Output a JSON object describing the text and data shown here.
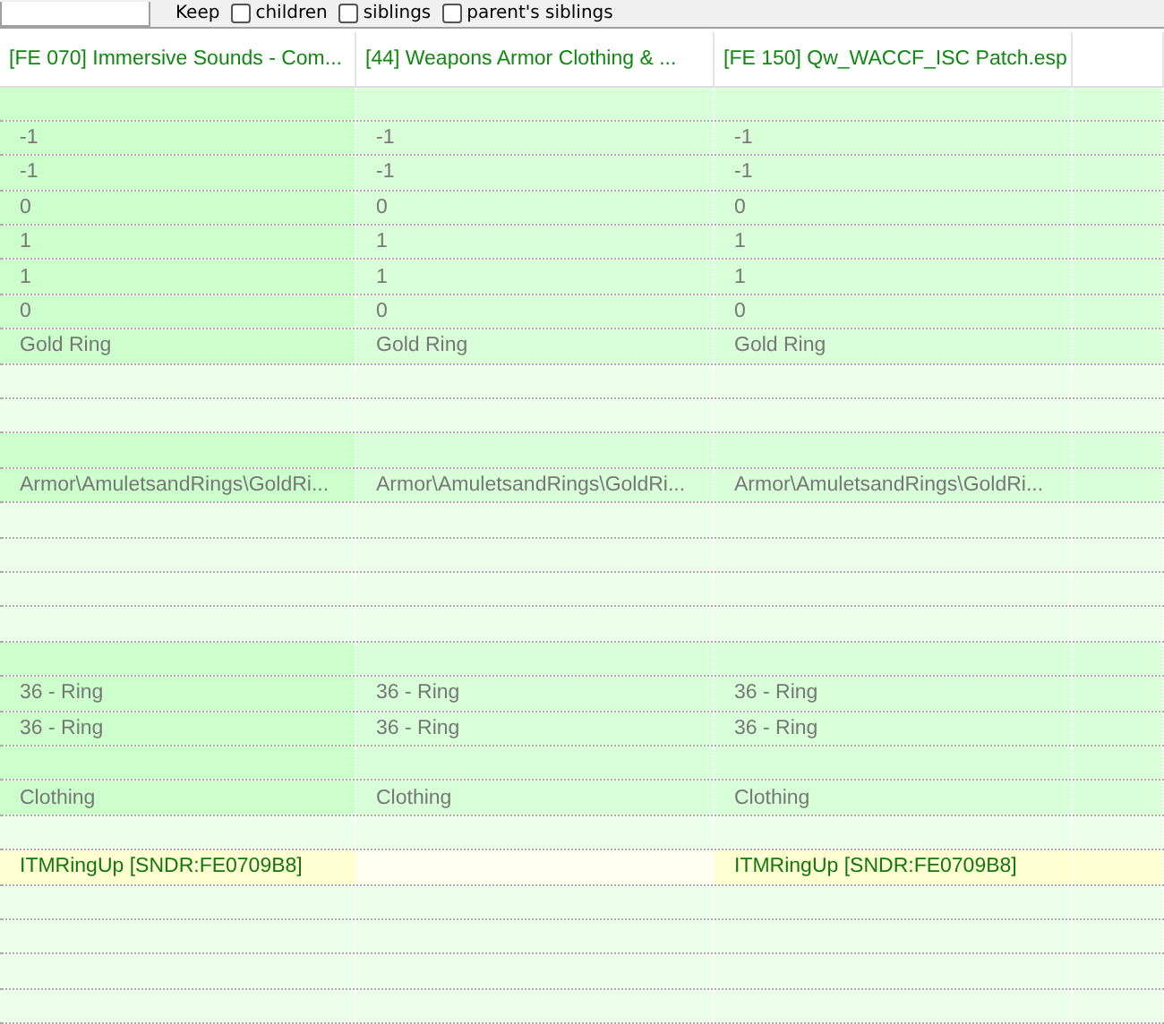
{
  "toolbar": {
    "label": "Keep",
    "options": [
      {
        "label": "children",
        "checked": false
      },
      {
        "label": "siblings",
        "checked": false
      },
      {
        "label": "parent's siblings",
        "checked": false
      }
    ]
  },
  "columns": [
    "[FE 070] Immersive Sounds - Com...",
    "[44] Weapons Armor Clothing & ...",
    "[FE 150] Qw_WACCF_ISC Patch.esp"
  ],
  "rows": [
    {
      "kind": "match"
    },
    {
      "kind": "match",
      "cells": [
        "-1",
        "-1",
        "-1"
      ]
    },
    {
      "kind": "match",
      "cells": [
        "-1",
        "-1",
        "-1"
      ]
    },
    {
      "kind": "match",
      "cells": [
        "0",
        "0",
        "0"
      ]
    },
    {
      "kind": "match",
      "cells": [
        "1",
        "1",
        "1"
      ]
    },
    {
      "kind": "match",
      "cells": [
        "1",
        "1",
        "1"
      ]
    },
    {
      "kind": "match",
      "cells": [
        "0",
        "0",
        "0"
      ]
    },
    {
      "kind": "match",
      "cells": [
        "Gold Ring",
        "Gold Ring",
        "Gold Ring"
      ]
    },
    {
      "kind": "empty"
    },
    {
      "kind": "empty"
    },
    {
      "kind": "match"
    },
    {
      "kind": "match",
      "cells": [
        "Armor\\AmuletsandRings\\GoldRi...",
        "Armor\\AmuletsandRings\\GoldRi...",
        "Armor\\AmuletsandRings\\GoldRi..."
      ]
    },
    {
      "kind": "empty"
    },
    {
      "kind": "empty"
    },
    {
      "kind": "empty"
    },
    {
      "kind": "empty"
    },
    {
      "kind": "match"
    },
    {
      "kind": "match",
      "cells": [
        "36 - Ring",
        "36 - Ring",
        "36 - Ring"
      ]
    },
    {
      "kind": "match",
      "cells": [
        "36 - Ring",
        "36 - Ring",
        "36 - Ring"
      ]
    },
    {
      "kind": "match"
    },
    {
      "kind": "match",
      "cells": [
        "Clothing",
        "Clothing",
        "Clothing"
      ]
    },
    {
      "kind": "empty"
    },
    {
      "kind": "conflict",
      "cells": [
        "ITMRingUp [SNDR:FE0709B8]",
        null,
        "ITMRingUp [SNDR:FE0709B8]"
      ]
    },
    {
      "kind": "empty"
    },
    {
      "kind": "empty"
    },
    {
      "kind": "empty"
    },
    {
      "kind": "empty"
    }
  ]
}
